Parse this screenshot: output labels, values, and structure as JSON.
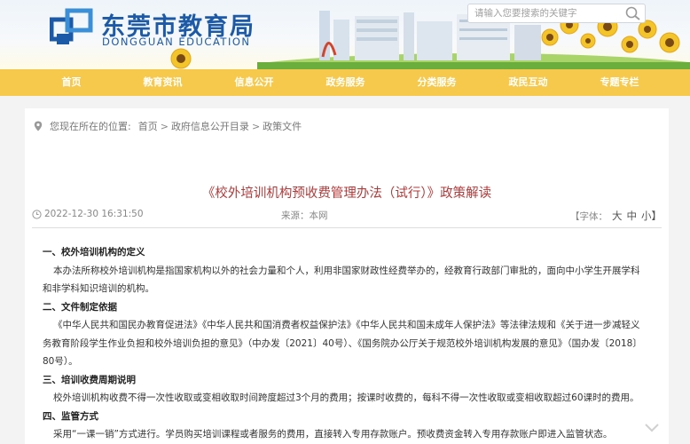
{
  "header": {
    "title": "东莞市教育局",
    "subtitle": "DONGGUAN EDUCATION",
    "search_placeholder": "请输入您要搜索的关键字"
  },
  "nav": {
    "items": [
      "首页",
      "教育资讯",
      "信息公开",
      "政务服务",
      "分类服务",
      "政民互动",
      "专题专栏"
    ]
  },
  "breadcrumb": {
    "prefix": "您现在所在的位置:",
    "items": [
      "首页",
      "政府信息公开目录",
      "政策文件"
    ],
    "separator": ">"
  },
  "article": {
    "title": "《校外培训机构预收费管理办法（试行）》政策解读",
    "date": "2022-12-30 16:31:50",
    "source": "来源：本网",
    "font_label": "【字体：",
    "font_large": "大",
    "font_medium": "中",
    "font_small": "小】",
    "sections": [
      {
        "heading": "一、校外培训机构的定义",
        "text": "本办法所称校外培训机构是指国家机构以外的社会力量和个人，利用非国家财政性经费举办的，经教育行政部门审批的，面向中小学生开展学科和非学科知识培训的机构。"
      },
      {
        "heading": "二、文件制定依据",
        "text": "《中华人民共和国民办教育促进法》《中华人民共和国消费者权益保护法》《中华人民共和国未成年人保护法》等法律法规和《关于进一步减轻义务教育阶段学生作业负担和校外培训负担的意见》（中办发〔2021〕40号）、《国务院办公厅关于规范校外培训机构发展的意见》（国办发〔2018〕80号）。"
      },
      {
        "heading": "三、培训收费周期说明",
        "text": "校外培训机构收费不得一次性收取或变相收取时间跨度超过3个月的费用；按课时收费的，每科不得一次性收取或变相收取超过60课时的费用。"
      },
      {
        "heading": "四、监管方式",
        "text": "采用“一课一销”方式进行。学员购买培训课程或者服务的费用，直接转入专用存款账户。预收费资金转入专用存款账户即进入监管状态。"
      }
    ]
  },
  "colors": {
    "nav_bg": "#f6c94c",
    "brand_blue": "#1c5aa8",
    "title_red": "#b23a3a"
  }
}
